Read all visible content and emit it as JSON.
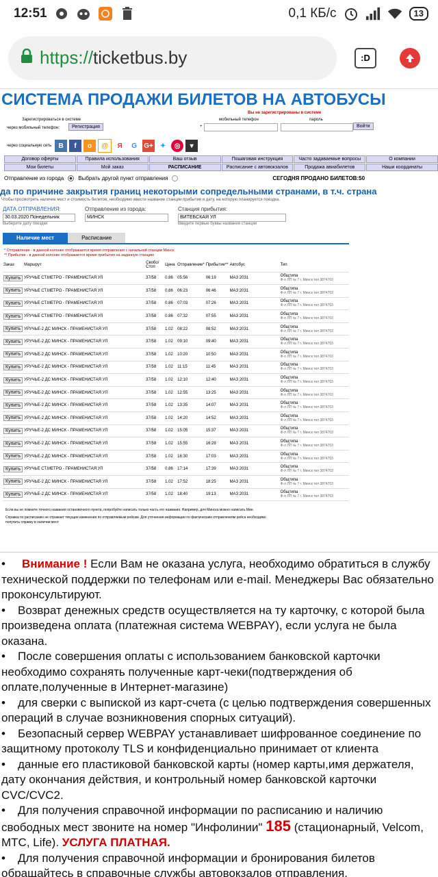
{
  "status_bar": {
    "time": "12:51",
    "speed": "0,1 КБ/с",
    "battery": "13"
  },
  "browser": {
    "scheme": "https://",
    "host": "ticketbus.by",
    "tabs_label": ":D"
  },
  "site": {
    "title": "СИСТЕМА ПРОДАЖИ БИЛЕТОВ НА АВТОБУСЫ",
    "login": {
      "not_registered": "Вы не зарегистрированы в системе",
      "register_prompt": "Зарегистрироваться в системе",
      "via_phone": "через мобильный телефон:",
      "register_button": "Регистрация",
      "phone_label": "мобильный телефон",
      "password_label": "пароль",
      "plus": "+",
      "login_button": "Войти",
      "via_social": "через социальную сеть"
    },
    "nav": [
      "Договор оферты",
      "Правила использования",
      "Ваш отзыв",
      "Пошаговая инструкция",
      "Часто задаваемые вопросы",
      "О компании",
      "Мои билеты",
      "Мой заказ",
      "РАСПИСАНИЕ",
      "Расписание с автовокзалов",
      "Продажа авиабилетов",
      "Наши координаты"
    ],
    "departure_options": {
      "from_city": "Отправление из города",
      "other_point": "Выбрать другой пункт отправления",
      "sold_today": "СЕГОДНЯ ПРОДАНО БИЛЕТОВ:50"
    },
    "marquee": "да по причине закрытия границ некоторыми сопредельными странами, в т.ч. страна",
    "hint": "Чтобы просмотреть наличие мест и стоимость билетов, необходимо ввести название станции прибытия и дату, на которую планируется поездка.",
    "form": {
      "date_label": "ДАТА ОТПРАВЛЕНИЯ:",
      "date_value": "30.03.2020 Понедельник",
      "date_hint": "Выберите дату поездки",
      "from_label": "Отправление из города:",
      "from_value": "МИНСК",
      "to_label": "Станция прибытия:",
      "to_value": "ВИТЕБСКАЯ УЛ",
      "to_hint": "Введите первые буквы названия станции"
    },
    "result_tabs": [
      "Наличие мест",
      "Расписание"
    ],
    "legend": [
      "* Отправление - в данной колонке отображается время отправления с начальной станции Минск",
      "** Прибытие - в данной колонке отображается время прибытия на заданную станцию"
    ],
    "table_headers": [
      "Заказ",
      "Маршрут",
      "Свобо/Стоп",
      "Цена",
      "Отправление*",
      "Прибытие**",
      "Автобус",
      "Тип"
    ],
    "buy_label": "Купить",
    "rows": [
      {
        "route": "УРУЧЬЕ СТ.МЕТРО - ПРАМЕНИСТАЯ УЛ",
        "seats": "37/58",
        "price": "0.86",
        "dep": "05:56",
        "arr": "06:19",
        "bus": "МАЗ 2031",
        "type": "Общтипа",
        "carrier": "Ф-л ЛП № 7 г. Минск тел 3874703"
      },
      {
        "route": "УРУЧЬЕ СТ.МЕТРО - ПРАМЕНИСТАЯ УЛ",
        "seats": "37/58",
        "price": "0.86",
        "dep": "06:23",
        "arr": "06:46",
        "bus": "МАЗ 2031",
        "type": "Общтипа",
        "carrier": "Ф-л ЛП № 7 г. Минск тел 3874703"
      },
      {
        "route": "УРУЧЬЕ СТ.МЕТРО - ПРАМЕНИСТАЯ УЛ",
        "seats": "37/58",
        "price": "0.86",
        "dep": "07:03",
        "arr": "07:26",
        "bus": "МАЗ 2031",
        "type": "Общтипа",
        "carrier": "Ф-л ЛП № 7 г. Минск тел 3874703"
      },
      {
        "route": "УРУЧЬЕ СТ.МЕТРО - ПРАМЕНИСТАЯ УЛ",
        "seats": "37/58",
        "price": "0.86",
        "dep": "07:32",
        "arr": "07:55",
        "bus": "МАЗ 2031",
        "type": "Общтипа",
        "carrier": "Ф-л ЛП № 7 г. Минск тел 3874703"
      },
      {
        "route": "УРУЧЬЕ-2 ДС МИНСК - ПРАМЕНИСТАЯ УЛ",
        "seats": "37/58",
        "price": "1.02",
        "dep": "08:22",
        "arr": "08:52",
        "bus": "МАЗ 2031",
        "type": "Общтипа",
        "carrier": "Ф-л ЛП № 7 г. Минск тел 3874703"
      },
      {
        "route": "УРУЧЬЕ-2 ДС МИНСК - ПРАМЕНИСТАЯ УЛ",
        "seats": "37/58",
        "price": "1.02",
        "dep": "09:10",
        "arr": "09:40",
        "bus": "МАЗ 2031",
        "type": "Общтипа",
        "carrier": "Ф-л ЛП № 7 г. Минск тел 3874703"
      },
      {
        "route": "УРУЧЬЕ-2 ДС МИНСК - ПРАМЕНИСТАЯ УЛ",
        "seats": "37/58",
        "price": "1.02",
        "dep": "10:20",
        "arr": "10:50",
        "bus": "МАЗ 2031",
        "type": "Общтипа",
        "carrier": "Ф-л ЛП № 7 г. Минск тел 3874703"
      },
      {
        "route": "УРУЧЬЕ-2 ДС МИНСК - ПРАМЕНИСТАЯ УЛ",
        "seats": "37/58",
        "price": "1.02",
        "dep": "11:15",
        "arr": "11:45",
        "bus": "МАЗ 2031",
        "type": "Общтипа",
        "carrier": "Ф-л ЛП № 7 г. Минск тел 3874703"
      },
      {
        "route": "УРУЧЬЕ-2 ДС МИНСК - ПРАМЕНИСТАЯ УЛ",
        "seats": "37/58",
        "price": "1.02",
        "dep": "12:10",
        "arr": "12:40",
        "bus": "МАЗ 2031",
        "type": "Общтипа",
        "carrier": "Ф-л ЛП № 7 г. Минск тел 3874703"
      },
      {
        "route": "УРУЧЬЕ-2 ДС МИНСК - ПРАМЕНИСТАЯ УЛ",
        "seats": "37/58",
        "price": "1.02",
        "dep": "12:55",
        "arr": "13:25",
        "bus": "МАЗ 2031",
        "type": "Общтипа",
        "carrier": "Ф-л ЛП № 7 г. Минск тел 3874703"
      },
      {
        "route": "УРУЧЬЕ-2 ДС МИНСК - ПРАМЕНИСТАЯ УЛ",
        "seats": "37/58",
        "price": "1.02",
        "dep": "13:35",
        "arr": "14:07",
        "bus": "МАЗ 2031",
        "type": "Общтипа",
        "carrier": "Ф-л ЛП № 7 г. Минск тел 3874703"
      },
      {
        "route": "УРУЧЬЕ-2 ДС МИНСК - ПРАМЕНИСТАЯ УЛ",
        "seats": "37/58",
        "price": "1.02",
        "dep": "14:20",
        "arr": "14:52",
        "bus": "МАЗ 2031",
        "type": "Общтипа",
        "carrier": "Ф-л ЛП № 7 г. Минск тел 3874703"
      },
      {
        "route": "УРУЧЬЕ-2 ДС МИНСК - ПРАМЕНИСТАЯ УЛ",
        "seats": "37/58",
        "price": "1.02",
        "dep": "15:05",
        "arr": "15:37",
        "bus": "МАЗ 2031",
        "type": "Общтипа",
        "carrier": "Ф-л ЛП № 7 г. Минск тел 3874703"
      },
      {
        "route": "УРУЧЬЕ-2 ДС МИНСК - ПРАМЕНИСТАЯ УЛ",
        "seats": "37/58",
        "price": "1.02",
        "dep": "15:55",
        "arr": "16:28",
        "bus": "МАЗ 2031",
        "type": "Общтипа",
        "carrier": "Ф-л ЛП № 7 г. Минск тел 3874703"
      },
      {
        "route": "УРУЧЬЕ-2 ДС МИНСК - ПРАМЕНИСТАЯ УЛ",
        "seats": "37/58",
        "price": "1.02",
        "dep": "16:30",
        "arr": "17:03",
        "bus": "МАЗ 2031",
        "type": "Общтипа",
        "carrier": "Ф-л ЛП № 7 г. Минск тел 3874703"
      },
      {
        "route": "УРУЧЬЕ СТ.МЕТРО - ПРАМЕНИСТАЯ УЛ",
        "seats": "37/58",
        "price": "0.86",
        "dep": "17:14",
        "arr": "17:39",
        "bus": "МАЗ 2031",
        "type": "Общтипа",
        "carrier": "Ф-л ЛП № 7 г. Минск тел 3874703"
      },
      {
        "route": "УРУЧЬЕ-2 ДС МИНСК - ПРАМЕНИСТАЯ УЛ",
        "seats": "37/58",
        "price": "1.02",
        "dep": "17:52",
        "arr": "18:25",
        "bus": "МАЗ 2031",
        "type": "Общтипа",
        "carrier": "Ф-л ЛП № 7 г. Минск тел 3874703"
      },
      {
        "route": "УРУЧЬЕ-2 ДС МИНСК - ПРАМЕНИСТАЯ УЛ",
        "seats": "37/58",
        "price": "1.02",
        "dep": "18:40",
        "arr": "19:13",
        "bus": "МАЗ 2031",
        "type": "Общтипа",
        "carrier": "Ф-л ЛП № 7 г. Минск тел 3874703"
      }
    ],
    "footnotes": [
      "Если вы не помните точного названия остановочного пункта, попробуйте написать только часть его названия. Например, для Минска можно написать Мин.",
      "Справка по расписанию не отражает текущие изменения по отправляемым рейсам. Для уточнения информации по фактическим отправлениям рейса необходимо получить справку в наличии мест"
    ]
  },
  "info": {
    "attention_label": "Внимание !",
    "attention_text": " Если Вам не оказана услуга, необходимо обратиться в службу технической поддержки по телефонам или e-mail. Менеджеры Вас обязательно проконсультируют.",
    "refund": "Возврат денежных средств осуществляется на ту карточку, с которой была произведена оплата (платежная система WEBPAY), если услуга не была оказана.",
    "after_payment": "После совершения оплаты с использованием банковской карточки необходимо сохранять полученные карт-чеки(подтверждения об оплате,полученные в Интернет-магазине)",
    "reconcile": "для сверки с выпиской из карт-счета (с целью подтверждения совершенных операций в случае возникновения спорных ситуаций).",
    "secure": "Безопасный сервер WEBPAY устанавливает шифрованное соединение по защитному протоколу TLS и конфиденциально принимает от клиента",
    "card_data": "данные его пластиковой банковской карты (номер карты,имя держателя, дату окончания действия, и контрольный номер банковской карточки CVC/CVC2.",
    "helpline_pre": "Для получения справочной информации по расписанию и наличию свободных мест звоните на номер \"Инфолинии\" ",
    "helpline_number": "185",
    "helpline_post": " (стационарный, Velcom, МТС, Life). ",
    "paid_service": "УСЛУГА ПЛАТНАЯ.",
    "booking": "Для получения справочной информации и бронирования билетов обращайтесь в справочные службы автовокзалов отправления."
  }
}
